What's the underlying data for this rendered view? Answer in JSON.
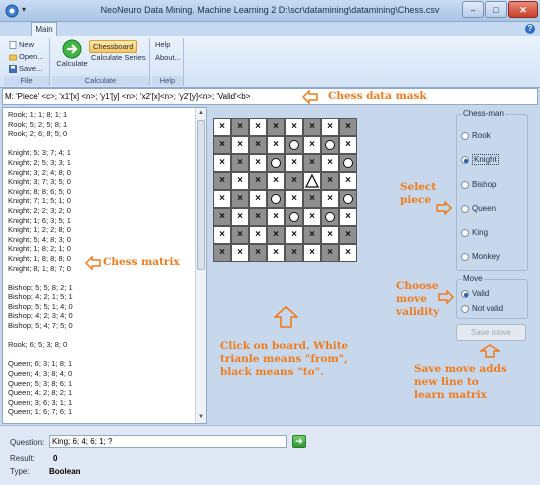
{
  "window": {
    "title": "NeoNeuro Data Mining. Machine Learning 2 D:\\scr\\datamining\\datamining\\Chess.csv",
    "minimize": "–",
    "maximize": "□",
    "close": "✕"
  },
  "tabs": {
    "main": "Main",
    "help": "?"
  },
  "ribbon": {
    "file": {
      "new": "New",
      "open": "Open...",
      "save": "Save...",
      "caption": "File"
    },
    "calculate": {
      "calculate": "Calculate",
      "chessboard": "Chessboard",
      "series": "Calculate Series",
      "caption": "Calculate"
    },
    "help": {
      "help": "Help",
      "about": "About...",
      "caption": "Help"
    }
  },
  "mask": {
    "value": "M: 'Piece' <c>; 'x1'[x] <n>; 'y1'[y] <n>; 'x2'[x]<n>; 'y2'[y]<n>; 'Valid'<b>",
    "annotation": "Chess data mask"
  },
  "matrix": {
    "lines": "Rook; 1; 1; 8; 1; 1\nRook; 5; 2; 5; 8; 1\nRook; 2; 6; 8; 5; 0\n\nKnight; 5; 3; 7; 4; 1\nKnight; 2; 5; 3; 3; 1\nKnight; 3; 2; 4; 8; 0\nKnight; 3; 7; 3; 5; 0\nKnight; 8; 8; 6; 5; 0\nKnight; 7; 1; 5; 1; 0\nKnight; 2; 2; 3; 2; 0\nKnight; 1; 6; 3; 5; 1\nKnight; 1; 2; 2; 8; 0\nKnight; 5; 4; 8; 3; 0\nKnight; 1; 8; 2; 1; 0\nKnight; 1; 8; 8; 8; 0\nKnight; 8; 1; 8; 7; 0\n\nBishop; 5; 5; 8; 2; 1\nBishop; 4; 2; 1; 5; 1\nBishop; 5; 5; 1; 4; 0\nBishop; 4; 2; 3; 4; 0\nBishop; 5; 4; 7; 5; 0\n\nRook; 6; 5; 3; 8; 0\n\nQueen; 6; 3; 1; 8; 1\nQueen; 4; 3; 8; 4; 0\nQueen; 5; 3; 8; 6; 1\nQueen; 4; 2; 8; 2; 1\nQueen; 3; 6; 3; 1; 1\nQueen; 1; 6; 7; 6; 1",
    "annotation": "Chess matrix"
  },
  "board": {
    "rows": [
      [
        "x",
        "x",
        "x",
        "x",
        "x",
        "x",
        "x",
        "x"
      ],
      [
        "x",
        "x",
        "x",
        "x",
        "o",
        "x",
        "o",
        "x"
      ],
      [
        "x",
        "x",
        "x",
        "o",
        "x",
        "x",
        "x",
        "o"
      ],
      [
        "x",
        "x",
        "x",
        "x",
        "x",
        "t",
        "x",
        "x"
      ],
      [
        "x",
        "x",
        "x",
        "o",
        "x",
        "x",
        "x",
        "o"
      ],
      [
        "x",
        "x",
        "x",
        "x",
        "o",
        "x",
        "o",
        "x"
      ],
      [
        "x",
        "x",
        "x",
        "x",
        "x",
        "x",
        "x",
        "x"
      ],
      [
        "x",
        "x",
        "x",
        "x",
        "x",
        "x",
        "x",
        "x"
      ]
    ],
    "annotation": "Click on board. White\ntrianle means \"from\",\nblack means \"to\"."
  },
  "chessman": {
    "legend": "Chess-man",
    "options": [
      "Rook",
      "Knight",
      "Bishop",
      "Queen",
      "King",
      "Monkey"
    ],
    "selected": "Knight",
    "annotation": "Select\npiece"
  },
  "move": {
    "legend": "Move",
    "options": [
      "Valid",
      "Not valid"
    ],
    "selected": "Valid",
    "annotation": "Choose\nmove\nvalidity",
    "save_label": "Save move",
    "save_annotation": "Save move adds\nnew line to\nlearn matrix"
  },
  "bottom": {
    "question_label": "Question:",
    "question_value": "King; 6; 4; 6; 1; ?",
    "result_label": "Result:",
    "result_value": "0",
    "type_label": "Type:",
    "type_value": "Boolean"
  },
  "colors": {
    "annotation": "#f07b1a",
    "dark_cell": "#8f8f8f",
    "panel": "#c8d8ec"
  }
}
